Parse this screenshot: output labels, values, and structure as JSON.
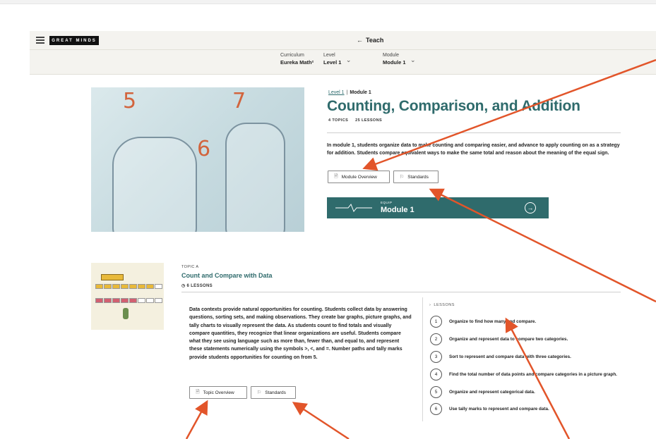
{
  "header": {
    "logo": "GREAT MINDS",
    "teach_arrow": "←",
    "teach": "Teach",
    "selectors": [
      {
        "label": "Curriculum",
        "value": "Eureka Math²"
      },
      {
        "label": "Level",
        "value": "Level 1"
      },
      {
        "label": "Module",
        "value": "Module 1"
      }
    ]
  },
  "hero": {
    "numbers": [
      "5",
      "7",
      "6"
    ]
  },
  "module": {
    "breadcrumb_link": "Level 1",
    "breadcrumb_current": "Module 1",
    "title": "Counting, Comparison, and Addition",
    "topics": "4 TOPICS",
    "lessons": "25 LESSONS",
    "description": "In module 1, students organize data to make counting and comparing easier, and advance to apply counting on as a strategy for addition. Students compare equivalent ways to make the same total and reason about the meaning of the equal sign.",
    "overview_button": "Module Overview",
    "standards_button": "Standards",
    "equip_label": "EQUIP",
    "equip_name": "Module 1"
  },
  "topic": {
    "kicker": "TOPIC A",
    "title": "Count and Compare with Data",
    "lessons_count": "6 LESSONS",
    "description": "Data contexts provide natural opportunities for counting. Students collect data by answering questions, sorting sets, and making observations. They create bar graphs, picture graphs, and tally charts to visually represent the data. As students count to find totals and visually compare quantities, they recognize that linear organizations are useful. Students compare what they see using language such as more than, fewer than, and equal to, and represent these statements numerically using the symbols >, <, and =. Number paths and tally marks provide students opportunities for counting on from 5.",
    "overview_button": "Topic Overview",
    "standards_button": "Standards",
    "lessons_header": "LESSONS",
    "lessons": [
      {
        "num": "1",
        "text": "Organize to find how many and compare."
      },
      {
        "num": "2",
        "text": "Organize and represent data to compare two categories."
      },
      {
        "num": "3",
        "text": "Sort to represent and compare data with three categories."
      },
      {
        "num": "4",
        "text": "Find the total number of data points and compare categories in a picture graph."
      },
      {
        "num": "5",
        "text": "Organize and represent categorical data."
      },
      {
        "num": "6",
        "text": "Use tally marks to represent and compare data."
      }
    ]
  },
  "colors": {
    "accent": "#2f6b6c",
    "annotation_arrow": "#e2552a",
    "number_orange": "#d2643d"
  }
}
